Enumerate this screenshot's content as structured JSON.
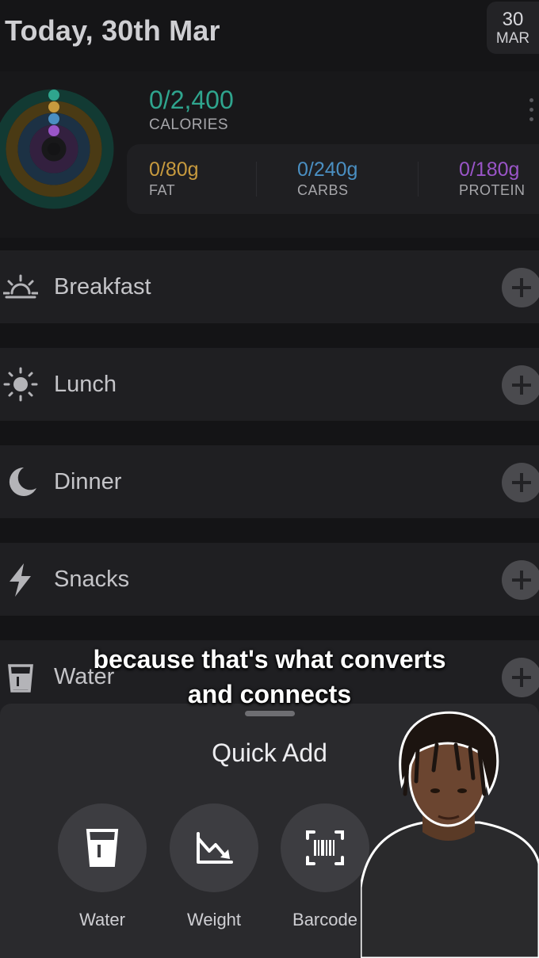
{
  "header": {
    "title": "Today, 30th Mar",
    "date_day": "30",
    "date_month": "MAR"
  },
  "summary": {
    "calories_value": "0/2,400",
    "calories_label": "CALORIES",
    "macros": [
      {
        "value": "0/80g",
        "label": "FAT",
        "color": "#c79a3e"
      },
      {
        "value": "0/240g",
        "label": "CARBS",
        "color": "#4a8fc2"
      },
      {
        "value": "0/180g",
        "label": "PROTEIN",
        "color": "#9a55c8"
      }
    ],
    "ring_colors": {
      "calories": "#2fa58e",
      "fat": "#c79a3e",
      "carbs": "#4a8fc2",
      "protein": "#9a55c8"
    }
  },
  "meals": [
    {
      "name": "Breakfast",
      "icon": "sunrise-icon"
    },
    {
      "name": "Lunch",
      "icon": "sun-icon"
    },
    {
      "name": "Dinner",
      "icon": "moon-icon"
    },
    {
      "name": "Snacks",
      "icon": "lightning-icon"
    },
    {
      "name": "Water",
      "icon": "glass-icon"
    }
  ],
  "caption": {
    "line1": "because that's what converts",
    "line2": "and connects"
  },
  "quick_add": {
    "title": "Quick Add",
    "items": [
      {
        "label": "Water",
        "icon": "glass-icon"
      },
      {
        "label": "Weight",
        "icon": "chart-down-icon"
      },
      {
        "label": "Barcode",
        "icon": "barcode-icon"
      }
    ]
  }
}
